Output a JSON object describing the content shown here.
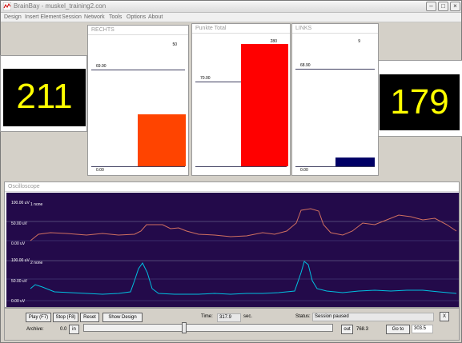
{
  "window": {
    "title": "BrainBay - muskel_training2.con",
    "icon": "brainbay-app-icon"
  },
  "menu": [
    "Design",
    "Insert Element",
    "Session",
    "Network",
    "Tools",
    "Options",
    "About"
  ],
  "counters": {
    "left_value": "211",
    "right_value": "179",
    "text_color": "#ffff00"
  },
  "bar_panels": [
    {
      "title": "RECHTS",
      "max_label": "50",
      "threshold_label": "69.90",
      "min_label": "0.00",
      "bar_color": "#ff4400",
      "bar_level": 0.43,
      "threshold_level": 0.8
    },
    {
      "title": "Punkte Total",
      "max_label": "280",
      "threshold_label": "70.00",
      "min_label": "",
      "bar_color": "#ff0000",
      "bar_level": 1.0,
      "threshold_level": 0.69
    },
    {
      "title": "LINKS",
      "max_label": "9",
      "threshold_label": "68.90",
      "min_label": "0.00",
      "bar_color": "#000066",
      "bar_level": 0.07,
      "threshold_level": 0.8
    }
  ],
  "oscilloscope": {
    "title": "Oscilloscope",
    "channels": [
      {
        "name": "1 none",
        "labels": [
          "100.00 uV",
          "50.00 uV",
          "0.00 uV"
        ],
        "color": "#d07060"
      },
      {
        "name": "2 none",
        "labels": [
          "100.00 uV",
          "50.00 uV",
          "0.00 uV"
        ],
        "color": "#00c0e0"
      }
    ]
  },
  "controls": {
    "play_label": "Play (F7)",
    "stop_label": "Stop (F8)",
    "reset_label": "Reset",
    "show_design_label": "Show Design",
    "time_label": "Time:",
    "time_value": "317.9",
    "time_unit": "sec.",
    "status_label": "Status:",
    "status_value": "Session paused",
    "close_label": "X",
    "archive_label": "Archive:",
    "archive_start": "0.0",
    "in_label": "in",
    "out_label": "out",
    "archive_end": "768.3",
    "goto_label": "Go to",
    "goto_value": "303.5",
    "archive_position": 0.4
  }
}
